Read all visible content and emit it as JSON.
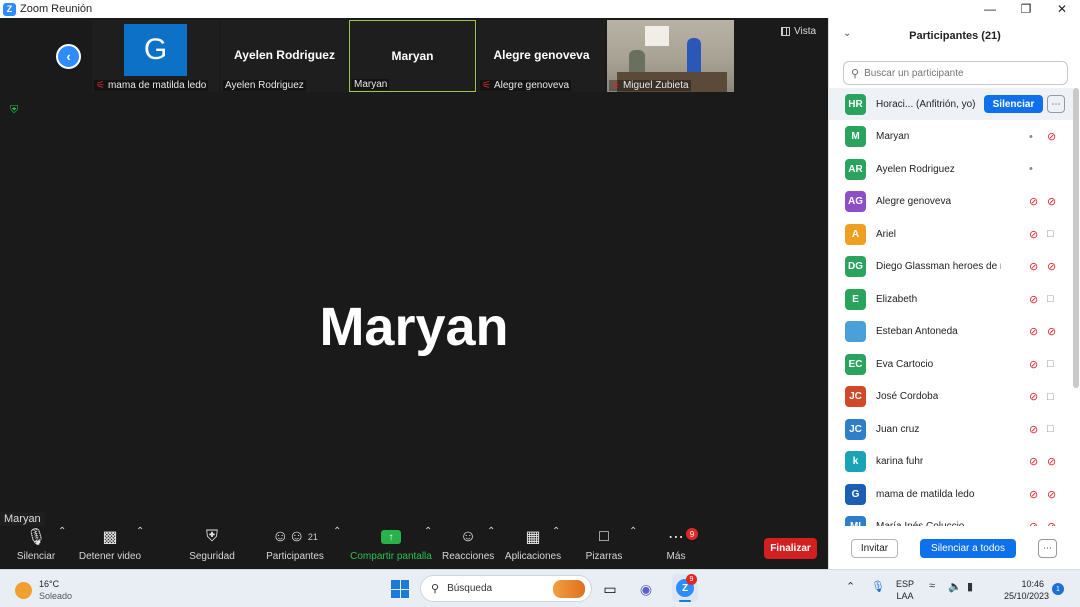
{
  "window": {
    "title": "Zoom Reunión"
  },
  "top_strip": {
    "tiles": [
      {
        "name": "",
        "label": "mama de matilda ledo",
        "avatar_letter": "G"
      },
      {
        "name": "Ayelen Rodriguez",
        "label": "Ayelen Rodriguez"
      },
      {
        "name": "Maryan",
        "label": "Maryan"
      },
      {
        "name": "Alegre genoveva",
        "label": "Alegre genoveva"
      },
      {
        "name": "",
        "label": "Miguel Zubieta"
      }
    ],
    "view_label": "Vista"
  },
  "active_speaker": {
    "name": "Maryan",
    "label": "Maryan"
  },
  "toolbar": {
    "mute": "Silenciar",
    "video": "Detener video",
    "security": "Seguridad",
    "participants": "Participantes",
    "participants_count": "21",
    "share": "Compartir pantalla",
    "reactions": "Reacciones",
    "apps": "Aplicaciones",
    "whiteboards": "Pizarras",
    "more": "Más",
    "more_badge": "9",
    "end": "Finalizar"
  },
  "panel": {
    "title": "Participantes (21)",
    "search_placeholder": "Buscar un participante",
    "silence_button": "Silenciar",
    "invite": "Invitar",
    "mute_all": "Silenciar a todos",
    "participants": [
      {
        "initials": "HR",
        "name": "Horaci... (Anfitrión, yo)",
        "color": "#2aa35e",
        "host": true
      },
      {
        "initials": "M",
        "name": "Maryan",
        "color": "#2aa35e",
        "mic": "on",
        "cam": "off"
      },
      {
        "initials": "AR",
        "name": "Ayelen Rodriguez",
        "color": "#2aa35e",
        "mic": "on",
        "cam": "none"
      },
      {
        "initials": "AG",
        "name": "Alegre genoveva",
        "color": "#8e4ec6",
        "mic": "muted",
        "cam": "off"
      },
      {
        "initials": "A",
        "name": "Ariel",
        "color": "#f0a020",
        "mic": "muted",
        "cam": "on"
      },
      {
        "initials": "DG",
        "name": "Diego Glassman heroes de ma...",
        "color": "#2aa35e",
        "mic": "muted",
        "cam": "off"
      },
      {
        "initials": "E",
        "name": "Elizabeth",
        "color": "#2aa35e",
        "mic": "muted",
        "cam": "on"
      },
      {
        "initials": "",
        "name": "Esteban Antoneda",
        "color": "#4aa0d8",
        "mic": "muted",
        "cam": "off"
      },
      {
        "initials": "EC",
        "name": "Eva Cartocio",
        "color": "#2aa35e",
        "mic": "muted",
        "cam": "on"
      },
      {
        "initials": "JC",
        "name": "José Cordoba",
        "color": "#d04a2a",
        "mic": "muted",
        "cam": "on"
      },
      {
        "initials": "JC",
        "name": "Juan cruz",
        "color": "#2f7ec8",
        "mic": "muted",
        "cam": "on"
      },
      {
        "initials": "k",
        "name": "karina fuhr",
        "color": "#19a3b5",
        "mic": "muted",
        "cam": "off"
      },
      {
        "initials": "G",
        "name": "mama de matilda ledo",
        "color": "#1a5fb4",
        "mic": "muted",
        "cam": "off"
      },
      {
        "initials": "MI",
        "name": "María Inés Coluccio",
        "color": "#2f7ec8",
        "mic": "muted",
        "cam": "off"
      }
    ]
  },
  "taskbar": {
    "weather_temp": "16°C",
    "weather_cond": "Soleado",
    "search_label": "Búsqueda",
    "zoom_badge": "9",
    "lang_top": "ESP",
    "lang_bottom": "LAA",
    "time": "10:46",
    "date": "25/10/2023",
    "notifications": "1"
  },
  "colors": {
    "accent": "#0e71eb",
    "end": "#d21f1f",
    "share": "#27b24a",
    "muted": "#e02828"
  }
}
